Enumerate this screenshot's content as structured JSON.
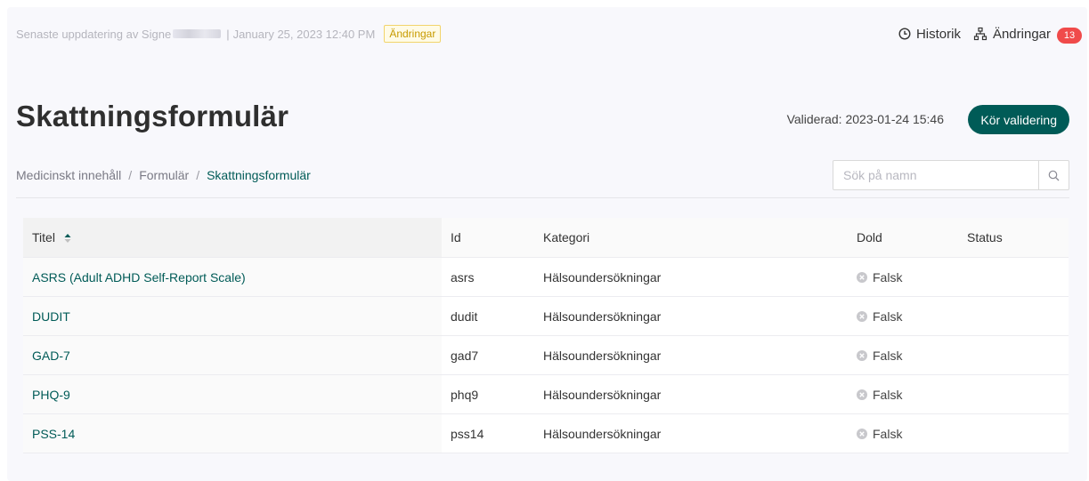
{
  "topbar": {
    "updated_prefix": "Senaste uppdatering av Signe",
    "separator": "|",
    "updated_date": "January 25, 2023 12:40 PM",
    "changes_badge": "Ändringar"
  },
  "actions": {
    "history_label": "Historik",
    "changes_label": "Ändringar",
    "changes_count": "13"
  },
  "header": {
    "title": "Skattningsformulär",
    "validated_text": "Validerad: 2023-01-24 15:46",
    "run_validation_label": "Kör validering"
  },
  "breadcrumb": {
    "items": [
      "Medicinskt innehåll",
      "Formulär",
      "Skattningsformulär"
    ],
    "separator": "/"
  },
  "search": {
    "placeholder": "Sök på namn"
  },
  "table": {
    "columns": [
      "Titel",
      "Id",
      "Kategori",
      "Dold",
      "Status"
    ],
    "rows": [
      {
        "title": "ASRS (Adult ADHD Self-Report Scale)",
        "id": "asrs",
        "category": "Hälsoundersökningar",
        "hidden": "Falsk",
        "status": ""
      },
      {
        "title": "DUDIT",
        "id": "dudit",
        "category": "Hälsoundersökningar",
        "hidden": "Falsk",
        "status": ""
      },
      {
        "title": "GAD-7",
        "id": "gad7",
        "category": "Hälsoundersökningar",
        "hidden": "Falsk",
        "status": ""
      },
      {
        "title": "PHQ-9",
        "id": "phq9",
        "category": "Hälsoundersökningar",
        "hidden": "Falsk",
        "status": ""
      },
      {
        "title": "PSS-14",
        "id": "pss14",
        "category": "Hälsoundersökningar",
        "hidden": "Falsk",
        "status": ""
      }
    ]
  },
  "icons": {
    "history": "clock-icon",
    "changes": "sitemap-icon",
    "search": "search-icon",
    "sort": "sort-icon",
    "hidden_false": "x-circle-icon"
  },
  "colors": {
    "primary": "#005b57",
    "badge_red": "#f04a4a",
    "warning_text": "#c79a00",
    "warning_bg": "#fffbe6"
  }
}
